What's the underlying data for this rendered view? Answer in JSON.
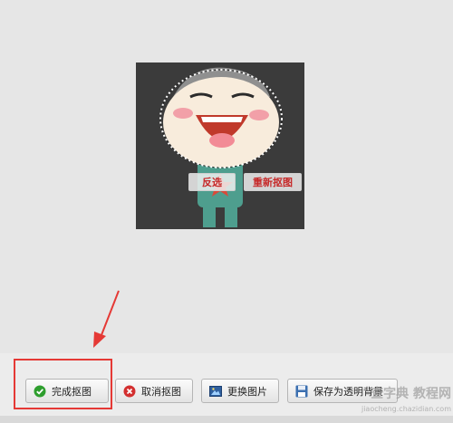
{
  "canvas": {
    "context_buttons": {
      "invert_label": "反选",
      "redo_label": "重新抠图"
    }
  },
  "toolbar": {
    "finish_label": "完成抠图",
    "cancel_label": "取消抠图",
    "change_label": "更换图片",
    "save_label": "保存为透明背景"
  },
  "watermark": {
    "main": "查字典 教程网",
    "url": "jiaocheng.chazidian.com"
  },
  "icons": {
    "finish": "check-circle-icon",
    "cancel": "x-circle-icon",
    "change": "picture-icon",
    "save": "floppy-disk-icon"
  },
  "colors": {
    "highlight": "#e53935",
    "arrow": "#e53935",
    "context_text": "#c62828",
    "check_green": "#2e9e2e",
    "cancel_red": "#d32f2f"
  }
}
